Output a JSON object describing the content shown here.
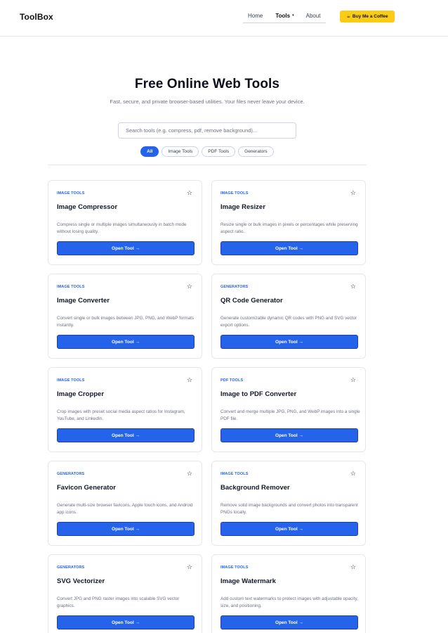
{
  "brand": "ToolBox",
  "nav": {
    "items": [
      {
        "label": "Home"
      },
      {
        "label": "Tools",
        "caret": "▾"
      },
      {
        "label": "About"
      }
    ],
    "coffee_icon": "☕",
    "coffee_label": "Buy Me a Coffee"
  },
  "hero": {
    "title": "Free Online Web Tools",
    "subtitle": "Fast, secure, and private browser-based utilities. Your files never leave your device.",
    "search_placeholder": "Search tools (e.g. compress, pdf, remove background)...",
    "filters": [
      {
        "label": "All",
        "active": true
      },
      {
        "label": "Image Tools",
        "active": false
      },
      {
        "label": "PDF Tools",
        "active": false
      },
      {
        "label": "Generators",
        "active": false
      }
    ]
  },
  "star_glyph": "☆",
  "colors": {
    "accent": "#2563eb",
    "coffee": "#facc15"
  },
  "tools": [
    {
      "category": "IMAGE TOOLS",
      "title": "Image Compressor",
      "description": "Compress single or multiple images simultaneously in batch mode without losing quality.",
      "button": "Open Tool →"
    },
    {
      "category": "IMAGE TOOLS",
      "title": "Image Resizer",
      "description": "Resize single or bulk images in pixels or percentages while preserving aspect ratio.",
      "button": "Open Tool →"
    },
    {
      "category": "IMAGE TOOLS",
      "title": "Image Converter",
      "description": "Convert single or bulk images between JPG, PNG, and WebP formats instantly.",
      "button": "Open Tool →"
    },
    {
      "category": "GENERATORS",
      "title": "QR Code Generator",
      "description": "Generate customizable dynamic QR codes with PNG and SVG vector export options.",
      "button": "Open Tool →"
    },
    {
      "category": "IMAGE TOOLS",
      "title": "Image Cropper",
      "description": "Crop images with preset social media aspect ratios for Instagram, YouTube, and LinkedIn.",
      "button": "Open Tool →"
    },
    {
      "category": "PDF TOOLS",
      "title": "Image to PDF Converter",
      "description": "Convert and merge multiple JPG, PNG, and WebP images into a single PDF file.",
      "button": "Open Tool →"
    },
    {
      "category": "GENERATORS",
      "title": "Favicon Generator",
      "description": "Generate multi-size browser favicons, Apple touch icons, and Android app icons.",
      "button": "Open Tool →"
    },
    {
      "category": "IMAGE TOOLS",
      "title": "Background Remover",
      "description": "Remove solid image backgrounds and convert photos into transparent PNGs locally.",
      "button": "Open Tool →"
    },
    {
      "category": "GENERATORS",
      "title": "SVG Vectorizer",
      "description": "Convert JPG and PNG raster images into scalable SVG vector graphics.",
      "button": "Open Tool →"
    },
    {
      "category": "IMAGE TOOLS",
      "title": "Image Watermark",
      "description": "Add custom text watermarks to protect images with adjustable opacity, size, and positioning.",
      "button": "Open Tool →"
    }
  ]
}
